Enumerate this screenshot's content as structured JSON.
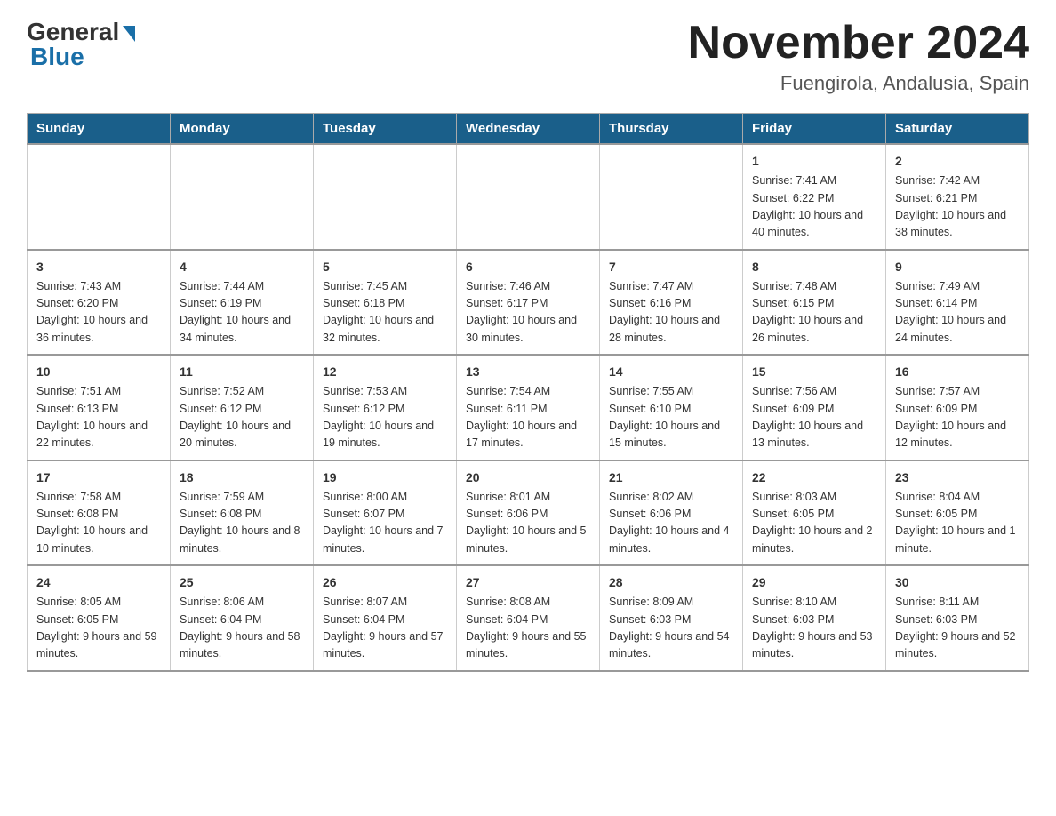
{
  "logo": {
    "general": "General",
    "blue": "Blue"
  },
  "title": "November 2024",
  "subtitle": "Fuengirola, Andalusia, Spain",
  "days_of_week": [
    "Sunday",
    "Monday",
    "Tuesday",
    "Wednesday",
    "Thursday",
    "Friday",
    "Saturday"
  ],
  "weeks": [
    [
      {
        "day": "",
        "info": ""
      },
      {
        "day": "",
        "info": ""
      },
      {
        "day": "",
        "info": ""
      },
      {
        "day": "",
        "info": ""
      },
      {
        "day": "",
        "info": ""
      },
      {
        "day": "1",
        "info": "Sunrise: 7:41 AM\nSunset: 6:22 PM\nDaylight: 10 hours and 40 minutes."
      },
      {
        "day": "2",
        "info": "Sunrise: 7:42 AM\nSunset: 6:21 PM\nDaylight: 10 hours and 38 minutes."
      }
    ],
    [
      {
        "day": "3",
        "info": "Sunrise: 7:43 AM\nSunset: 6:20 PM\nDaylight: 10 hours and 36 minutes."
      },
      {
        "day": "4",
        "info": "Sunrise: 7:44 AM\nSunset: 6:19 PM\nDaylight: 10 hours and 34 minutes."
      },
      {
        "day": "5",
        "info": "Sunrise: 7:45 AM\nSunset: 6:18 PM\nDaylight: 10 hours and 32 minutes."
      },
      {
        "day": "6",
        "info": "Sunrise: 7:46 AM\nSunset: 6:17 PM\nDaylight: 10 hours and 30 minutes."
      },
      {
        "day": "7",
        "info": "Sunrise: 7:47 AM\nSunset: 6:16 PM\nDaylight: 10 hours and 28 minutes."
      },
      {
        "day": "8",
        "info": "Sunrise: 7:48 AM\nSunset: 6:15 PM\nDaylight: 10 hours and 26 minutes."
      },
      {
        "day": "9",
        "info": "Sunrise: 7:49 AM\nSunset: 6:14 PM\nDaylight: 10 hours and 24 minutes."
      }
    ],
    [
      {
        "day": "10",
        "info": "Sunrise: 7:51 AM\nSunset: 6:13 PM\nDaylight: 10 hours and 22 minutes."
      },
      {
        "day": "11",
        "info": "Sunrise: 7:52 AM\nSunset: 6:12 PM\nDaylight: 10 hours and 20 minutes."
      },
      {
        "day": "12",
        "info": "Sunrise: 7:53 AM\nSunset: 6:12 PM\nDaylight: 10 hours and 19 minutes."
      },
      {
        "day": "13",
        "info": "Sunrise: 7:54 AM\nSunset: 6:11 PM\nDaylight: 10 hours and 17 minutes."
      },
      {
        "day": "14",
        "info": "Sunrise: 7:55 AM\nSunset: 6:10 PM\nDaylight: 10 hours and 15 minutes."
      },
      {
        "day": "15",
        "info": "Sunrise: 7:56 AM\nSunset: 6:09 PM\nDaylight: 10 hours and 13 minutes."
      },
      {
        "day": "16",
        "info": "Sunrise: 7:57 AM\nSunset: 6:09 PM\nDaylight: 10 hours and 12 minutes."
      }
    ],
    [
      {
        "day": "17",
        "info": "Sunrise: 7:58 AM\nSunset: 6:08 PM\nDaylight: 10 hours and 10 minutes."
      },
      {
        "day": "18",
        "info": "Sunrise: 7:59 AM\nSunset: 6:08 PM\nDaylight: 10 hours and 8 minutes."
      },
      {
        "day": "19",
        "info": "Sunrise: 8:00 AM\nSunset: 6:07 PM\nDaylight: 10 hours and 7 minutes."
      },
      {
        "day": "20",
        "info": "Sunrise: 8:01 AM\nSunset: 6:06 PM\nDaylight: 10 hours and 5 minutes."
      },
      {
        "day": "21",
        "info": "Sunrise: 8:02 AM\nSunset: 6:06 PM\nDaylight: 10 hours and 4 minutes."
      },
      {
        "day": "22",
        "info": "Sunrise: 8:03 AM\nSunset: 6:05 PM\nDaylight: 10 hours and 2 minutes."
      },
      {
        "day": "23",
        "info": "Sunrise: 8:04 AM\nSunset: 6:05 PM\nDaylight: 10 hours and 1 minute."
      }
    ],
    [
      {
        "day": "24",
        "info": "Sunrise: 8:05 AM\nSunset: 6:05 PM\nDaylight: 9 hours and 59 minutes."
      },
      {
        "day": "25",
        "info": "Sunrise: 8:06 AM\nSunset: 6:04 PM\nDaylight: 9 hours and 58 minutes."
      },
      {
        "day": "26",
        "info": "Sunrise: 8:07 AM\nSunset: 6:04 PM\nDaylight: 9 hours and 57 minutes."
      },
      {
        "day": "27",
        "info": "Sunrise: 8:08 AM\nSunset: 6:04 PM\nDaylight: 9 hours and 55 minutes."
      },
      {
        "day": "28",
        "info": "Sunrise: 8:09 AM\nSunset: 6:03 PM\nDaylight: 9 hours and 54 minutes."
      },
      {
        "day": "29",
        "info": "Sunrise: 8:10 AM\nSunset: 6:03 PM\nDaylight: 9 hours and 53 minutes."
      },
      {
        "day": "30",
        "info": "Sunrise: 8:11 AM\nSunset: 6:03 PM\nDaylight: 9 hours and 52 minutes."
      }
    ]
  ]
}
